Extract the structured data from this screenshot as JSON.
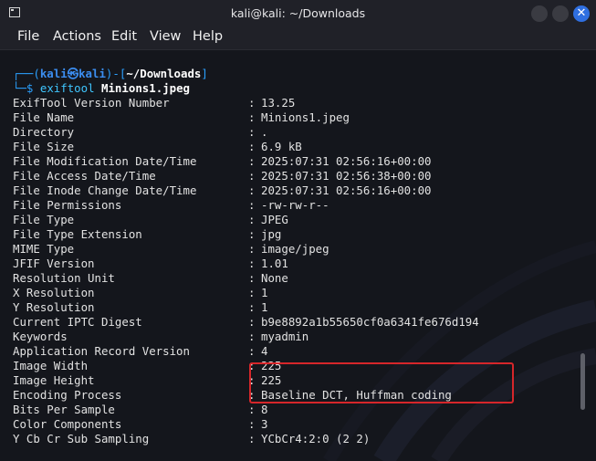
{
  "window": {
    "title": "kali@kali: ~/Downloads",
    "close_glyph": "✕"
  },
  "menu": {
    "items": [
      "File",
      "Actions",
      "Edit",
      "View",
      "Help"
    ]
  },
  "prompt": {
    "line1_open": "┌──(",
    "user": "kali",
    "at": "㉿",
    "host": "kali",
    "line1_mid": ")-[",
    "path": "~/Downloads",
    "line1_close": "]",
    "line2_prefix": "└─$",
    "command": "exiftool",
    "argument": "Minions1.jpeg"
  },
  "separator": ":",
  "rows": [
    {
      "key": "ExifTool Version Number",
      "value": "13.25"
    },
    {
      "key": "File Name",
      "value": "Minions1.jpeg"
    },
    {
      "key": "Directory",
      "value": "."
    },
    {
      "key": "File Size",
      "value": "6.9 kB"
    },
    {
      "key": "File Modification Date/Time",
      "value": "2025:07:31 02:56:16+00:00"
    },
    {
      "key": "File Access Date/Time",
      "value": "2025:07:31 02:56:38+00:00"
    },
    {
      "key": "File Inode Change Date/Time",
      "value": "2025:07:31 02:56:16+00:00"
    },
    {
      "key": "File Permissions",
      "value": "-rw-rw-r--"
    },
    {
      "key": "File Type",
      "value": "JPEG"
    },
    {
      "key": "File Type Extension",
      "value": "jpg"
    },
    {
      "key": "MIME Type",
      "value": "image/jpeg"
    },
    {
      "key": "JFIF Version",
      "value": "1.01"
    },
    {
      "key": "Resolution Unit",
      "value": "None"
    },
    {
      "key": "X Resolution",
      "value": "1"
    },
    {
      "key": "Y Resolution",
      "value": "1"
    },
    {
      "key": "Current IPTC Digest",
      "value": "b9e8892a1b55650cf0a6341fe676d194"
    },
    {
      "key": "Keywords",
      "value": "myadmin"
    },
    {
      "key": "Application Record Version",
      "value": "4"
    },
    {
      "key": "Image Width",
      "value": "225"
    },
    {
      "key": "Image Height",
      "value": "225"
    },
    {
      "key": "Encoding Process",
      "value": "Baseline DCT, Huffman coding"
    },
    {
      "key": "Bits Per Sample",
      "value": "8"
    },
    {
      "key": "Color Components",
      "value": "3"
    },
    {
      "key": "Y Cb Cr Sub Sampling",
      "value": "YCbCr4:2:0 (2 2)"
    }
  ],
  "colors": {
    "accent_blue": "#2aa0ff",
    "highlight_red": "#d6262a",
    "terminal_bg": "#14161c"
  },
  "icons": {
    "terminal": "terminal-icon",
    "minimize": "minimize-icon",
    "maximize": "maximize-icon",
    "close": "close-icon"
  }
}
